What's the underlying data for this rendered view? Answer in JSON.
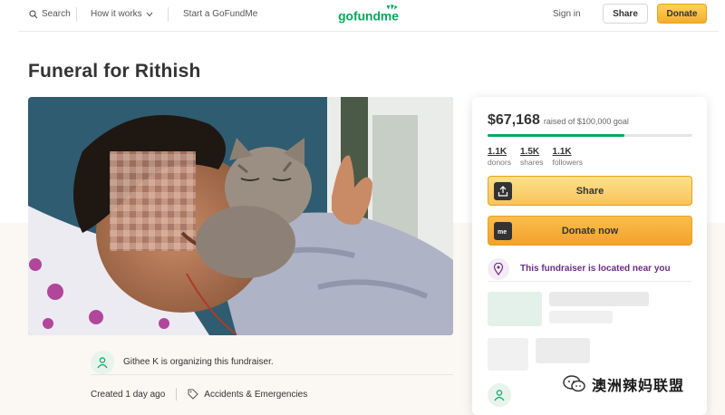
{
  "header": {
    "search_label": "Search",
    "how_label": "How it works",
    "start_label": "Start a GoFundMe",
    "logo_text": "gofundme",
    "signin_label": "Sign in",
    "share_label": "Share",
    "donate_label": "Donate"
  },
  "campaign": {
    "title": "Funeral for Rithish",
    "organizer_text": "Githee K is organizing this fundraiser.",
    "created": "Created 1 day ago",
    "category": "Accidents & Emergencies"
  },
  "donate_card": {
    "raised": "$67,168",
    "goal_text": "raised of $100,000 goal",
    "progress_fraction": 0.67,
    "stats": [
      {
        "value": "1.1K",
        "label": "donors"
      },
      {
        "value": "1.5K",
        "label": "shares"
      },
      {
        "value": "1.1K",
        "label": "followers"
      }
    ],
    "share_button": "Share",
    "donate_button": "Donate now",
    "location_text": "This fundraiser is located near you"
  },
  "watermark": {
    "text": "澳洲辣妈联盟"
  },
  "colors": {
    "brand_green": "#02a95c",
    "donate_orange": "#f5ae2c",
    "location_purple": "#6c2d85"
  }
}
